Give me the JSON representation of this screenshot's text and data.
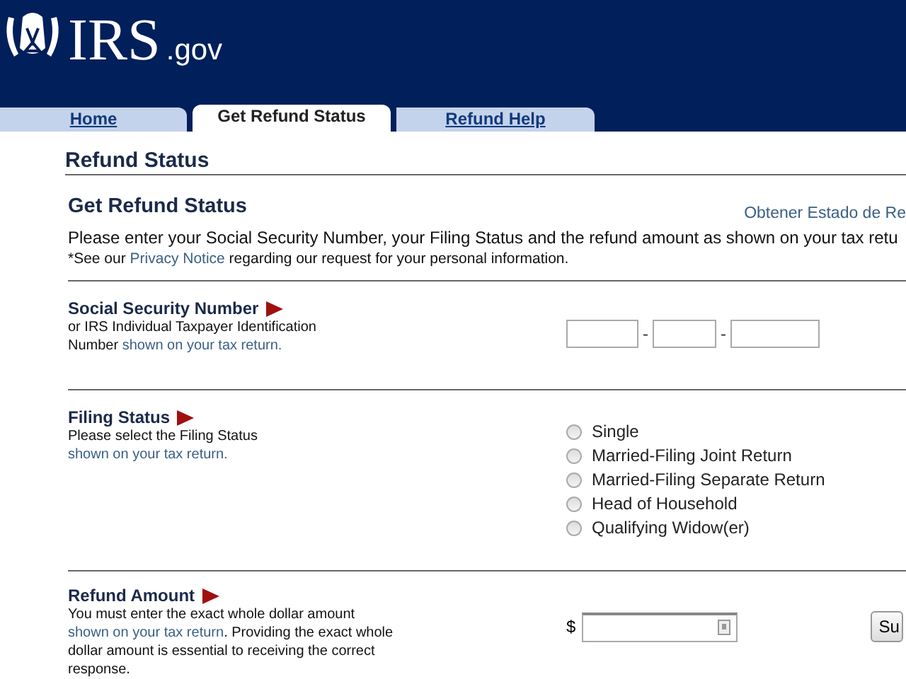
{
  "header": {
    "logo_text": "IRS",
    "logo_suffix": ".gov"
  },
  "tabs": [
    {
      "label": "Home",
      "selected": false
    },
    {
      "label": "Get Refund Status",
      "selected": true
    },
    {
      "label": "Refund Help",
      "selected": false
    }
  ],
  "page_title": "Refund Status",
  "form": {
    "title": "Get Refund Status",
    "language_link": "Obtener Estado de Re",
    "intro": "Please enter your Social Security Number, your Filing Status and the refund amount as shown on your tax retu",
    "privacy_note": {
      "before": "*See our ",
      "link": "Privacy Notice",
      "after": " regarding our request for your personal information."
    }
  },
  "sections": [
    {
      "kind": "ssn",
      "title": "Social Security Number",
      "description": "or IRS Individual Taxpayer Identification Number ",
      "link": "shown on your tax return.",
      "separators": [
        "-",
        "-"
      ]
    },
    {
      "kind": "filing",
      "title": "Filing Status",
      "description": "Please select the Filing Status ",
      "link": "shown on your tax return.",
      "options": [
        {
          "label": "Single",
          "selected": false
        },
        {
          "label": "Married-Filing Joint Return",
          "selected": false
        },
        {
          "label": "Married-Filing Separate Return",
          "selected": false
        },
        {
          "label": "Head of Household",
          "selected": false
        },
        {
          "label": "Qualifying Widow(er)",
          "selected": false
        }
      ]
    },
    {
      "kind": "amount",
      "title": "Refund Amount",
      "description": "You must enter the exact whole dollar amount ",
      "link": "shown on your tax return",
      "after": ". Providing the exact whole dollar amount is essential to receiving the correct response.",
      "currency": "$",
      "button": "Su"
    }
  ]
}
